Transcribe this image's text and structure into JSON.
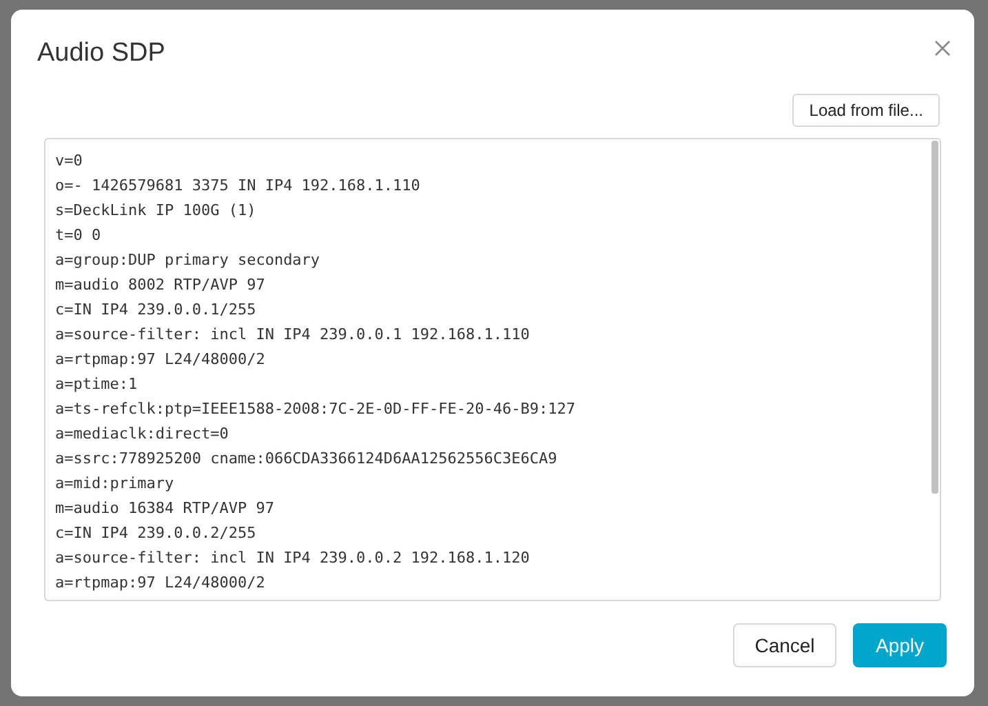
{
  "dialog": {
    "title": "Audio SDP"
  },
  "load_button": "Load from file...",
  "sdp_lines": [
    "v=0",
    "o=- 1426579681 3375 IN IP4 192.168.1.110",
    "s=DeckLink IP 100G (1)",
    "t=0 0",
    "a=group:DUP primary secondary",
    "m=audio 8002 RTP/AVP 97",
    "c=IN IP4 239.0.0.1/255",
    "a=source-filter: incl IN IP4 239.0.0.1 192.168.1.110",
    "a=rtpmap:97 L24/48000/2",
    "a=ptime:1",
    "a=ts-refclk:ptp=IEEE1588-2008:7C-2E-0D-FF-FE-20-46-B9:127",
    "a=mediaclk:direct=0",
    "a=ssrc:778925200 cname:066CDA3366124D6AA12562556C3E6CA9",
    "a=mid:primary",
    "m=audio 16384 RTP/AVP 97",
    "c=IN IP4 239.0.0.2/255",
    "a=source-filter: incl IN IP4 239.0.0.2 192.168.1.120",
    "a=rtpmap:97 L24/48000/2"
  ],
  "buttons": [
    {
      "label": "Cancel",
      "kind": "secondary"
    },
    {
      "label": "Apply",
      "kind": "primary"
    }
  ]
}
